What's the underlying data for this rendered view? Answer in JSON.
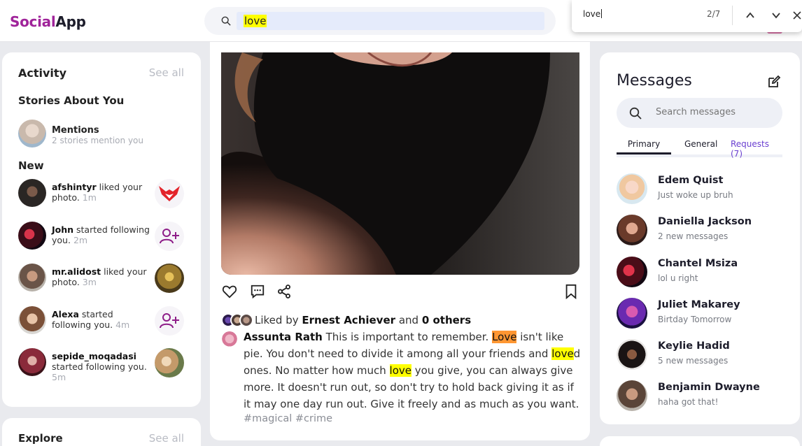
{
  "header": {
    "logo_part1": "Social",
    "logo_part2": "App",
    "search_value": "love",
    "accent": "#a0249a"
  },
  "find_bar": {
    "query": "love",
    "match_count": "2/7",
    "prev_icon": "chevron-up-icon",
    "next_icon": "chevron-down-icon",
    "close_icon": "close-icon"
  },
  "activity": {
    "title": "Activity",
    "see_all": "See all",
    "stories_heading": "Stories About You",
    "mention": {
      "name": "Mentions",
      "sub": "2 stories mention you"
    },
    "new_heading": "New",
    "notifications": [
      {
        "user": "afshintyr",
        "action": " liked your photo.",
        "time": "1m",
        "right": "photo"
      },
      {
        "user": "John",
        "action": " started following you.",
        "time": "2m",
        "right": "follow"
      },
      {
        "user": "mr.alidost",
        "action": " liked your photo.",
        "time": "3m",
        "right": "photo"
      },
      {
        "user": "Alexa",
        "action": " started following you.",
        "time": "4m",
        "right": "follow"
      },
      {
        "user": "sepide_moqadasi",
        "action": " started following you.",
        "time": "5m",
        "right": "photo"
      }
    ]
  },
  "explore": {
    "title": "Explore",
    "see_all": "See all"
  },
  "post": {
    "likes_prefix": "Liked by ",
    "liked_by": "Ernest Achiever",
    "likes_mid": " and ",
    "others": "0 others",
    "author": "Assunta Rath",
    "caption_parts": [
      " This is important to remember. ",
      "Love",
      " isn't like pie. You don't need to divide it among all your friends and ",
      "love",
      "d ones. No matter how much ",
      "love",
      " you give, you can always give more. It doesn't run out, so don't try to hold back giving it as if it may one day run out. Give it freely and as much as you want."
    ],
    "tags": "#magical #crime"
  },
  "messages": {
    "title": "Messages",
    "search_placeholder": "Search messages",
    "tabs": [
      "Primary",
      "General",
      "Requests (7)"
    ],
    "contacts": [
      {
        "name": "Edem Quist",
        "msg": "Just woke up bruh"
      },
      {
        "name": "Daniella Jackson",
        "msg": "2 new messages"
      },
      {
        "name": "Chantel Msiza",
        "msg": "lol u right"
      },
      {
        "name": "Juliet Makarey",
        "msg": "Birtday Tomorrow"
      },
      {
        "name": "Keylie Hadid",
        "msg": "5 new messages"
      },
      {
        "name": "Benjamin Dwayne",
        "msg": "haha got that!"
      }
    ]
  }
}
